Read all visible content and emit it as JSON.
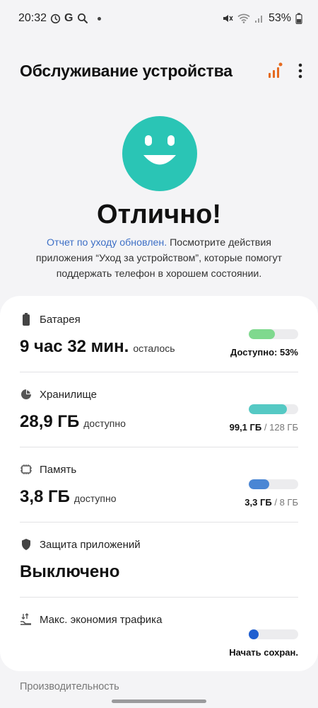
{
  "status_bar": {
    "time": "20:32",
    "g_letter": "G",
    "battery_percent": "53%",
    "icons": [
      "alarm-icon",
      "google-icon",
      "search-icon",
      "notification-dot",
      "mute-icon",
      "wifi-icon",
      "signal-icon",
      "battery-icon"
    ]
  },
  "header": {
    "title": "Обслуживание устройства",
    "icons": [
      "diagnostics-icon",
      "more-options-icon"
    ]
  },
  "hero": {
    "status_text": "Отлично!",
    "link_text": "Отчет по уходу обновлен.",
    "description": " Посмотрите действия приложения “Уход за устройством”, которые помогут поддержать телефон в хорошем состоянии.",
    "face_color": "#2ac5b5"
  },
  "items": {
    "battery": {
      "label": "Батарея",
      "value": "9 час 32 мин.",
      "value_suffix": "осталось",
      "right_text": "Доступно: 53%",
      "level": 0.53,
      "color": "#7fd98e"
    },
    "storage": {
      "label": "Хранилище",
      "value": "28,9 ГБ",
      "value_suffix": "доступно",
      "used": "99,1 ГБ",
      "separator": "/",
      "total": "128 ГБ",
      "level": 0.77,
      "color": "#55c9c4"
    },
    "memory": {
      "label": "Память",
      "value": "3,8 ГБ",
      "value_suffix": "доступно",
      "used": "3,3 ГБ",
      "separator": "/",
      "total": "8 ГБ",
      "level": 0.41,
      "color": "#4a86d4"
    },
    "protection": {
      "label": "Защита приложений",
      "value": "Выключено"
    },
    "data_saver": {
      "label": "Макс. экономия трафика",
      "right_text": "Начать сохран.",
      "toggle_on": false
    }
  },
  "section_label": "Производительность"
}
